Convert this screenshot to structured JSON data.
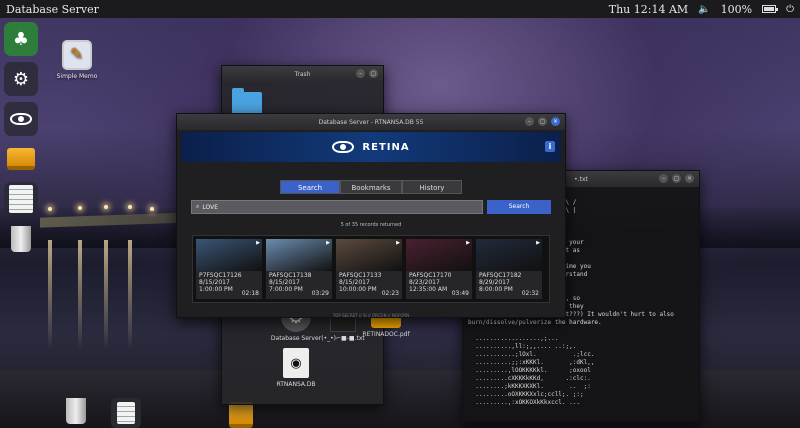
{
  "top_panel": {
    "app_title": "Database Server",
    "datetime": "Thu 12:14 AM",
    "battery": "100%",
    "battery_level": 1.0
  },
  "dock": {
    "items": [
      {
        "name": "solitaire",
        "glyph": "♣"
      },
      {
        "name": "settings",
        "glyph": "⚙"
      },
      {
        "name": "retina-eye",
        "glyph": "◉"
      },
      {
        "name": "drive"
      },
      {
        "name": "memo"
      },
      {
        "name": "trash"
      }
    ]
  },
  "desktop_icons": {
    "simple_memo": "Simple Memo"
  },
  "trash_window": {
    "title": "Trash",
    "files": [
      {
        "label": "Database Server"
      },
      {
        "label": "(•_•)⌐■-■.txt"
      },
      {
        "label": "RETINADOC.pdf"
      },
      {
        "label": "RTNANSA.DB"
      }
    ]
  },
  "terminal": {
    "title_suffix": "•.txt",
    "lines": [
      "",
      "  \\  / /  \\  <    / /\\ \\  /\\ /",
      "   \\/ |  \\ \\ ~  / ___ \\| | \\ |",
      "    \\_\\ \\_|_|\\_\\ \\_|_\\ \\_\\",
      "",
      "dump of Retina before they",
      "his is what came up against your",
      " this is everything you want as",
      "lready partioned against",
      "es to cover the period of time you",
      " of the faces -- NOW I understand",
      "stuff!",
      "",
      "t will erase the hard-drive, so",
      "ake you into custody (which they",
      "will -- you know this, right???) It wouldn't hurt to also",
      "burn/dissolve/pulverize the hardware.",
      "",
      "  ..................,;...  ",
      "  ..........,ll:;,,.... ..:;,. ",
      "  ...........;lOxl.          .;lcc.",
      "  ..........;;:xKKKl.       ,:dKl,,",
      "  .........,lOOKKKKkl.      ;oxool",
      "  .........cXKKKkKKd,      .:clc:.",
      "  ........;kKKKXKXKl.       ..  ;:",
      "  .........oOXKKKXxlc;ccll;. ;:;  ",
      "  .........,:xOKKOXkKkxccl. ..."
    ]
  },
  "db_window": {
    "title": "Database Server - RTNANSA.DB 55",
    "banner_title": "RETINA",
    "tabs": [
      "Search",
      "Bookmarks",
      "History"
    ],
    "active_tab": 0,
    "search_value": "LOVE",
    "search_button": "Search",
    "records_text": "5 of 35 records returned",
    "footer_text": "TOP SECRET // SI // ORCON // NOFORN",
    "results": [
      {
        "id": "P7FSQC17126",
        "date": "8/15/2017",
        "time": "1:00:00 PM",
        "duration": "02:18",
        "thumb_color": "#3a5576"
      },
      {
        "id": "PAFSQC17138",
        "date": "8/15/2017",
        "time": "7:00:00 PM",
        "duration": "03:29",
        "thumb_color": "#6b8cb0"
      },
      {
        "id": "PAFSQC17133",
        "date": "8/15/2017",
        "time": "10:00:00 PM",
        "duration": "02:23",
        "thumb_color": "#5b4a3e"
      },
      {
        "id": "PAFSQC17170",
        "date": "8/23/2017",
        "time": "12:35:00 AM",
        "duration": "03:49",
        "thumb_color": "#4a2030"
      },
      {
        "id": "PAFSQC17182",
        "date": "8/29/2017",
        "time": "8:00:00 PM",
        "duration": "02:32",
        "thumb_color": "#222a3a"
      }
    ]
  }
}
